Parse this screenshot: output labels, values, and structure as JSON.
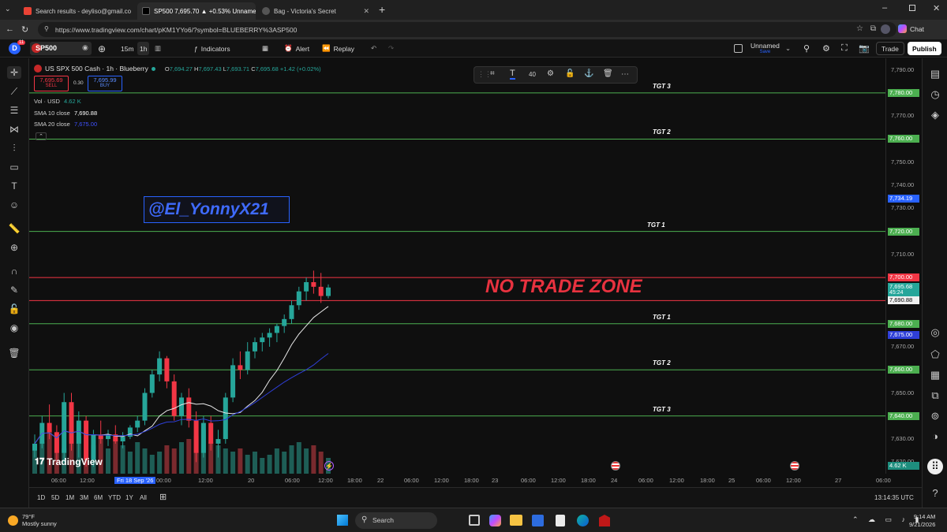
{
  "browser": {
    "tabs": [
      {
        "label": "Search results - deyliso@gmail.co",
        "icon": "gmail-icon",
        "active": false
      },
      {
        "label": "SP500 7,695.70 ▲ +0.53% Unnamed",
        "icon": "tradingview-icon",
        "active": true
      },
      {
        "label": "Bag - Victoria's Secret",
        "icon": "victorias-secret-icon",
        "active": false
      }
    ],
    "url": "https://www.tradingview.com/chart/pKM1YYo6/?symbol=BLUEBERRY%3ASP500",
    "chat_label": "Chat"
  },
  "toolbar": {
    "avatar_letter": "D",
    "notif_count": "11",
    "symbol": "SP500",
    "intervals": [
      "15m",
      "1h"
    ],
    "indicators_label": "Indicators",
    "alert_label": "Alert",
    "replay_label": "Replay",
    "layout_name": "Unnamed",
    "layout_status": "Save",
    "trade_label": "Trade",
    "publish_label": "Publish"
  },
  "legend": {
    "title": "US SPX 500 Cash · 1h · Blueberry",
    "open": "7,694.27",
    "high": "7,697.43",
    "low": "7,693.71",
    "close": "7,695.68",
    "change": "+1.42 (+0.02%)",
    "sell_price": "7,695.69",
    "sell_label": "SELL",
    "spread": "0.30",
    "buy_price": "7,695.99",
    "buy_label": "BUY",
    "vol_label": "Vol · USD",
    "vol_value": "4.62 K",
    "sma10_label": "SMA 10 close",
    "sma10_value": "7,690.88",
    "sma20_label": "SMA 20 close",
    "sma20_value": "7,675.00"
  },
  "drawing_toolbar": {
    "font_size": "40"
  },
  "chart": {
    "watermark": "@El_YonnyX21",
    "zone_text": "NO TRADE ZONE",
    "logo_text": "TradingView",
    "levels": [
      {
        "label": "TGT 3",
        "price": 7780,
        "price_label": "7,780.00",
        "color": "#4caf50"
      },
      {
        "label": "TGT 2",
        "price": 7760,
        "price_label": "7,760.00",
        "color": "#4caf50"
      },
      {
        "label": "TGT 1",
        "price": 7720,
        "price_label": "7,720.00",
        "color": "#4caf50"
      },
      {
        "label": "",
        "price": 7700,
        "price_label": "7,700.00",
        "color": "#f23645"
      },
      {
        "label": "",
        "price": 7690,
        "price_label": "7,690.00",
        "color": "#f23645"
      },
      {
        "label": "TGT 1",
        "price": 7680,
        "price_label": "7,680.00",
        "color": "#4caf50"
      },
      {
        "label": "TGT 2",
        "price": 7660,
        "price_label": "7,660.00",
        "color": "#4caf50"
      },
      {
        "label": "TGT 3",
        "price": 7640,
        "price_label": "7,640.00",
        "color": "#4caf50"
      }
    ],
    "price_ticks": [
      "7,790.00",
      "7,770.00",
      "7,750.00",
      "7,740.00",
      "7,730.00",
      "7,710.00",
      "7,670.00",
      "7,650.00",
      "7,630.00",
      "7,620.00"
    ],
    "price_tick_values": [
      7790,
      7770,
      7750,
      7740,
      7730,
      7710,
      7670,
      7650,
      7630,
      7620
    ],
    "current_price": "7,695.68",
    "countdown": "45:24",
    "sma10_tag": "7,690.88",
    "sma20_tag": "7,675.00",
    "other_tag": "7,734.19",
    "volume_tag": "4.62 K",
    "time_ticks": [
      "06:00",
      "12:00",
      "Fri 18 Sep '26",
      "00:00",
      "12:00",
      "20",
      "06:00",
      "12:00",
      "18:00",
      "22",
      "06:00",
      "12:00",
      "18:00",
      "23",
      "06:00",
      "12:00",
      "18:00",
      "24",
      "06:00",
      "12:00",
      "18:00",
      "25",
      "06:00",
      "12:00",
      "27",
      "06:00"
    ],
    "timezone": "13:14:35 UTC"
  },
  "chart_data": {
    "type": "candlestick",
    "title": "US SPX 500 Cash · 1h · Blueberry",
    "ylim": [
      7615,
      7795
    ],
    "candles": [
      [
        7625,
        7632,
        7622,
        7628
      ],
      [
        7628,
        7640,
        7626,
        7637
      ],
      [
        7637,
        7645,
        7630,
        7633
      ],
      [
        7633,
        7636,
        7620,
        7624
      ],
      [
        7624,
        7650,
        7620,
        7646
      ],
      [
        7646,
        7650,
        7625,
        7628
      ],
      [
        7628,
        7642,
        7622,
        7638
      ],
      [
        7638,
        7640,
        7618,
        7621
      ],
      [
        7621,
        7634,
        7618,
        7632
      ],
      [
        7632,
        7638,
        7628,
        7630
      ],
      [
        7630,
        7634,
        7627,
        7632
      ],
      [
        7632,
        7636,
        7628,
        7629
      ],
      [
        7629,
        7633,
        7626,
        7631
      ],
      [
        7631,
        7636,
        7630,
        7635
      ],
      [
        7635,
        7640,
        7633,
        7638
      ],
      [
        7638,
        7652,
        7636,
        7650
      ],
      [
        7650,
        7660,
        7648,
        7658
      ],
      [
        7658,
        7668,
        7655,
        7665
      ],
      [
        7665,
        7666,
        7652,
        7655
      ],
      [
        7655,
        7658,
        7638,
        7640
      ],
      [
        7640,
        7650,
        7636,
        7648
      ],
      [
        7648,
        7652,
        7635,
        7638
      ],
      [
        7638,
        7642,
        7620,
        7624
      ],
      [
        7624,
        7640,
        7622,
        7637
      ],
      [
        7637,
        7640,
        7625,
        7628
      ],
      [
        7628,
        7634,
        7622,
        7630
      ],
      [
        7630,
        7650,
        7628,
        7648
      ],
      [
        7648,
        7665,
        7646,
        7662
      ],
      [
        7662,
        7668,
        7656,
        7660
      ],
      [
        7660,
        7672,
        7658,
        7668
      ],
      [
        7668,
        7674,
        7665,
        7672
      ],
      [
        7672,
        7676,
        7668,
        7674
      ],
      [
        7674,
        7678,
        7670,
        7676
      ],
      [
        7676,
        7680,
        7672,
        7679
      ],
      [
        7679,
        7684,
        7676,
        7682
      ],
      [
        7682,
        7690,
        7680,
        7688
      ],
      [
        7688,
        7696,
        7686,
        7694
      ],
      [
        7694,
        7700,
        7690,
        7698
      ],
      [
        7698,
        7703,
        7693,
        7696
      ],
      [
        7696,
        7702,
        7689,
        7692
      ],
      [
        7692,
        7697,
        7691,
        7695.68
      ]
    ],
    "volumes": [
      9,
      10,
      14,
      11,
      8,
      15,
      12,
      13,
      9,
      12,
      8,
      11,
      9,
      7,
      10,
      8,
      6,
      7,
      9,
      8,
      10,
      11,
      12,
      14,
      10,
      9,
      8,
      7,
      8,
      6,
      7,
      5,
      6,
      8,
      7,
      9,
      10,
      8,
      9,
      7,
      5
    ]
  }
}
